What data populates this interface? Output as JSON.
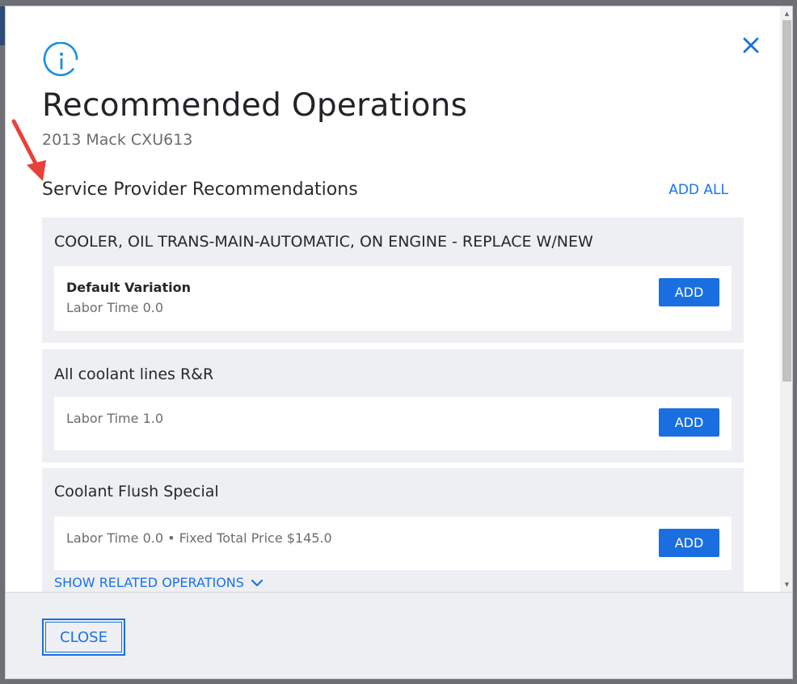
{
  "dialog": {
    "title": "Recommended Operations",
    "subtitle": "2013 Mack CXU613",
    "close_icon": "close-x-icon",
    "info_icon": "info-icon"
  },
  "section": {
    "title": "Service Provider Recommendations",
    "add_all_label": "ADD ALL"
  },
  "operations": [
    {
      "title": "COOLER, OIL TRANS-MAIN-AUTOMATIC, ON ENGINE - REPLACE W/NEW",
      "variation_name": "Default Variation",
      "meta": "Labor Time 0.0",
      "add_label": "ADD"
    },
    {
      "title": "All coolant lines R&R",
      "variation_name": "",
      "meta": "Labor Time 1.0",
      "add_label": "ADD"
    },
    {
      "title": "Coolant Flush Special",
      "variation_name": "",
      "meta": "Labor Time 0.0 • Fixed Total Price $145.0",
      "add_label": "ADD",
      "show_related_label": "SHOW RELATED OPERATIONS"
    }
  ],
  "footer": {
    "close_label": "CLOSE"
  },
  "colors": {
    "accent": "#1a6fe0",
    "card_bg": "#eeeff3",
    "annotation_arrow": "#e8413a"
  }
}
